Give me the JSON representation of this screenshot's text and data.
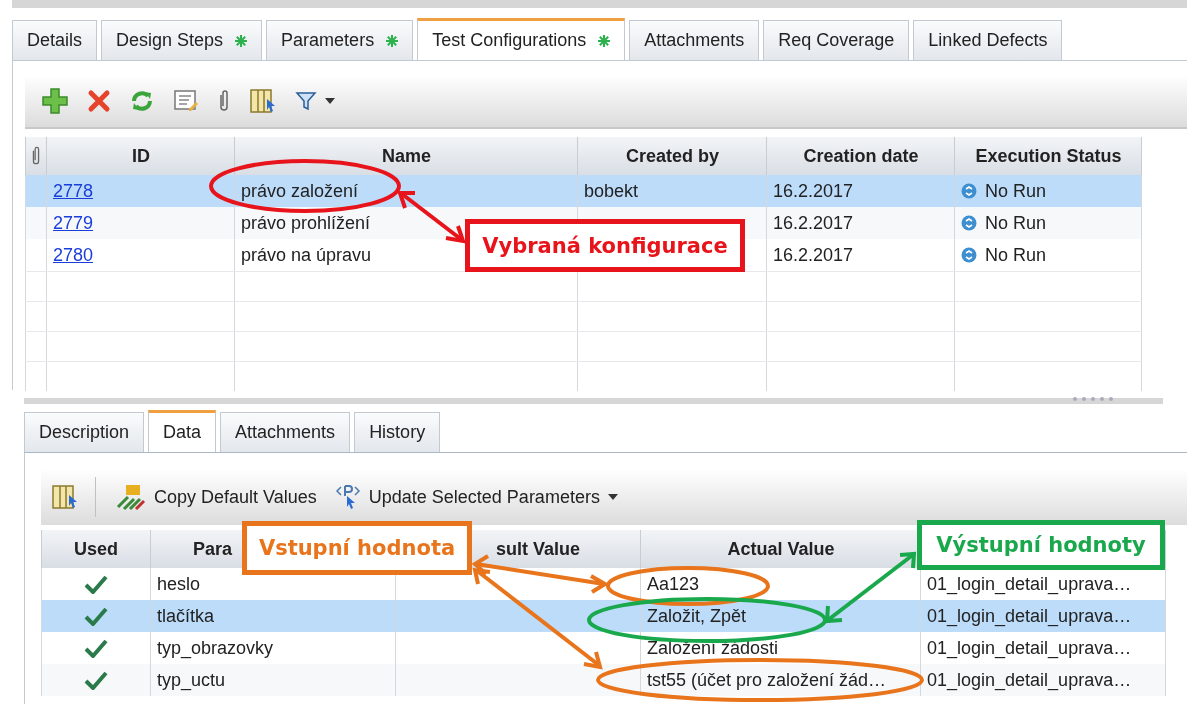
{
  "tabs": [
    {
      "label": "Details",
      "modified": false,
      "selected": false
    },
    {
      "label": "Design Steps",
      "modified": true,
      "selected": false
    },
    {
      "label": "Parameters",
      "modified": true,
      "selected": false
    },
    {
      "label": "Test Configurations",
      "modified": true,
      "selected": true
    },
    {
      "label": "Attachments",
      "modified": false,
      "selected": false
    },
    {
      "label": "Req Coverage",
      "modified": false,
      "selected": false
    },
    {
      "label": "Linked Defects",
      "modified": false,
      "selected": false
    }
  ],
  "configurations": {
    "columns": [
      "ID",
      "Name",
      "Created by",
      "Creation date",
      "Execution Status"
    ],
    "rows": [
      {
        "id": "2778",
        "name": "právo založení",
        "created_by": "bobekt",
        "date": "16.2.2017",
        "status": "No Run",
        "selected": true
      },
      {
        "id": "2779",
        "name": "právo prohlížení",
        "date": "16.2.2017",
        "status": "No Run",
        "selected": false
      },
      {
        "id": "2780",
        "name": "právo na úpravu",
        "date": "16.2.2017",
        "status": "No Run",
        "selected": false
      }
    ]
  },
  "detail_tabs": [
    {
      "label": "Description",
      "selected": false
    },
    {
      "label": "Data",
      "selected": true
    },
    {
      "label": "Attachments",
      "selected": false
    },
    {
      "label": "History",
      "selected": false
    }
  ],
  "data_toolbar": {
    "copy": "Copy Default Values",
    "update": "Update Selected Parameters"
  },
  "parameters": {
    "columns": [
      "Used",
      "Para",
      "sult Value",
      "Actual Value"
    ],
    "rows": [
      {
        "used": true,
        "parameter": "heslo",
        "actual": "Aa123",
        "column_5": "01_login_detail_uprava…",
        "selected": false
      },
      {
        "used": true,
        "parameter": "tlačítka",
        "actual": "Založit, Zpět",
        "column_5": "01_login_detail_uprava…",
        "selected": true
      },
      {
        "used": true,
        "parameter": "typ_obrazovky",
        "actual": "Založení žádosti",
        "column_5": "01_login_detail_uprava…",
        "selected": false
      },
      {
        "used": true,
        "parameter": "typ_uctu",
        "actual": "tst55 (účet pro založení žád…",
        "column_5": "01_login_detail_uprava…",
        "selected": false
      }
    ]
  },
  "annotations": [
    {
      "text": "Vybraná konfigurace",
      "color": "#e8141b"
    },
    {
      "text": "Vstupní hodnota",
      "color": "#e8741c"
    },
    {
      "text": "Výstupní hodnoty",
      "color": "#1aa84c"
    }
  ]
}
